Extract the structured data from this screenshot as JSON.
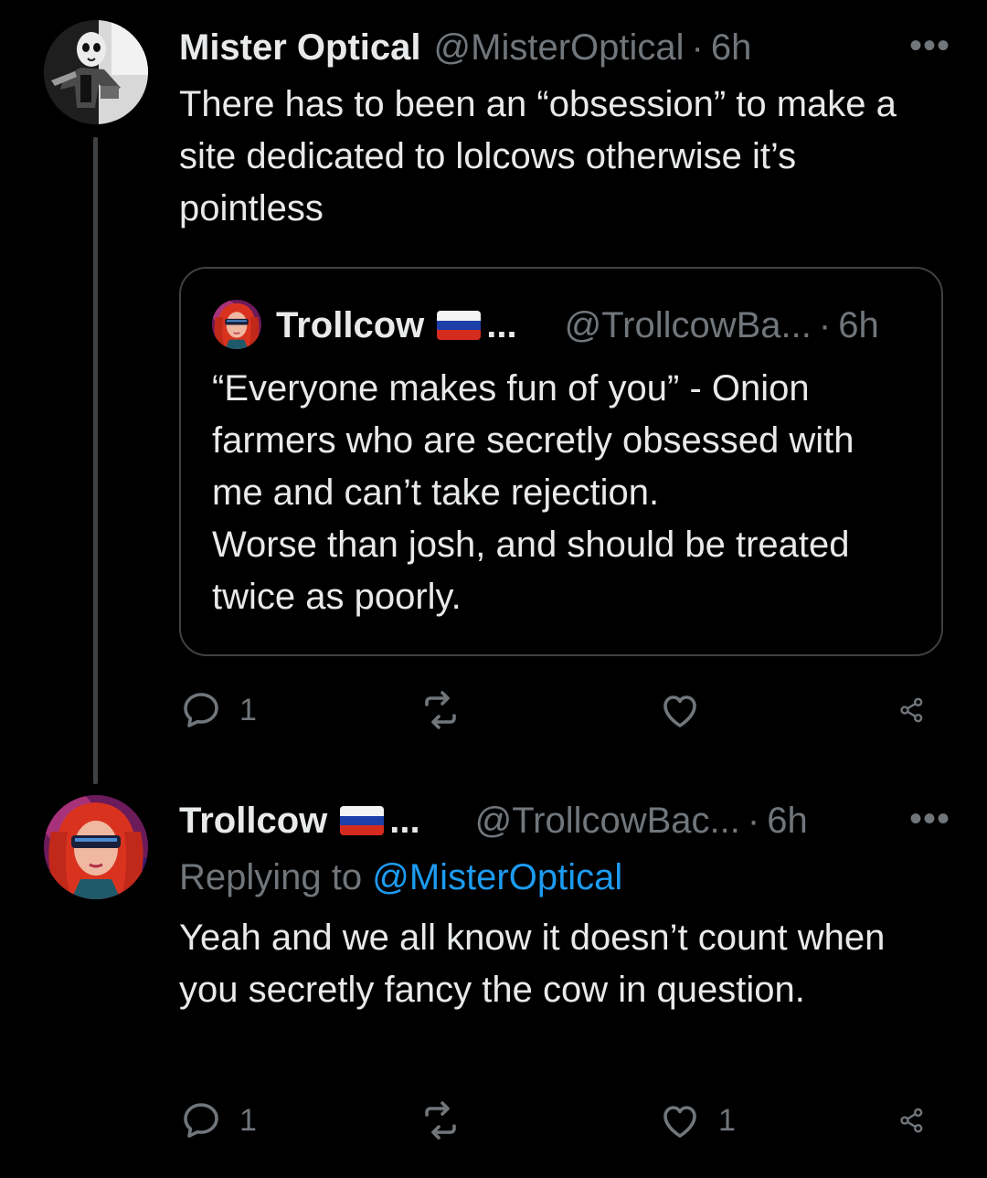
{
  "tweets": [
    {
      "name": "Mister Optical",
      "handle": "@MisterOptical",
      "separator": "·",
      "time": "6h",
      "more_label": "•••",
      "text": "There has to been an “obsession” to make a site dedicated to lolcows otherwise it’s pointless",
      "quote": {
        "name": "Trollcow",
        "flag": "russia-flag-emoji",
        "name_truncation": "...",
        "handle": "@TrollcowBa...",
        "separator": "·",
        "time": "6h",
        "text_lines": [
          "“Everyone makes fun of you” - Onion farmers who are secretly obsessed with me and can’t take rejection.",
          "Worse than josh, and should be treated twice as poorly."
        ]
      },
      "actions": {
        "reply_count": "1",
        "retweet_count": "",
        "like_count": "",
        "share_count": ""
      }
    },
    {
      "name": "Trollcow",
      "flag": "russia-flag-emoji",
      "name_truncation": "...",
      "handle": "@TrollcowBac...",
      "separator": "·",
      "time": "6h",
      "more_label": "•••",
      "replying_prefix": "Replying to",
      "replying_to": "@MisterOptical",
      "text": "Yeah and we all know it doesn’t count when you secretly fancy the cow in question.",
      "actions": {
        "reply_count": "1",
        "retweet_count": "",
        "like_count": "1",
        "share_count": ""
      }
    }
  ],
  "colors": {
    "background": "#000000",
    "primary_text": "#e7e9ea",
    "secondary_text": "#71767b",
    "link": "#1d9bf0",
    "border": "#3e4144"
  }
}
